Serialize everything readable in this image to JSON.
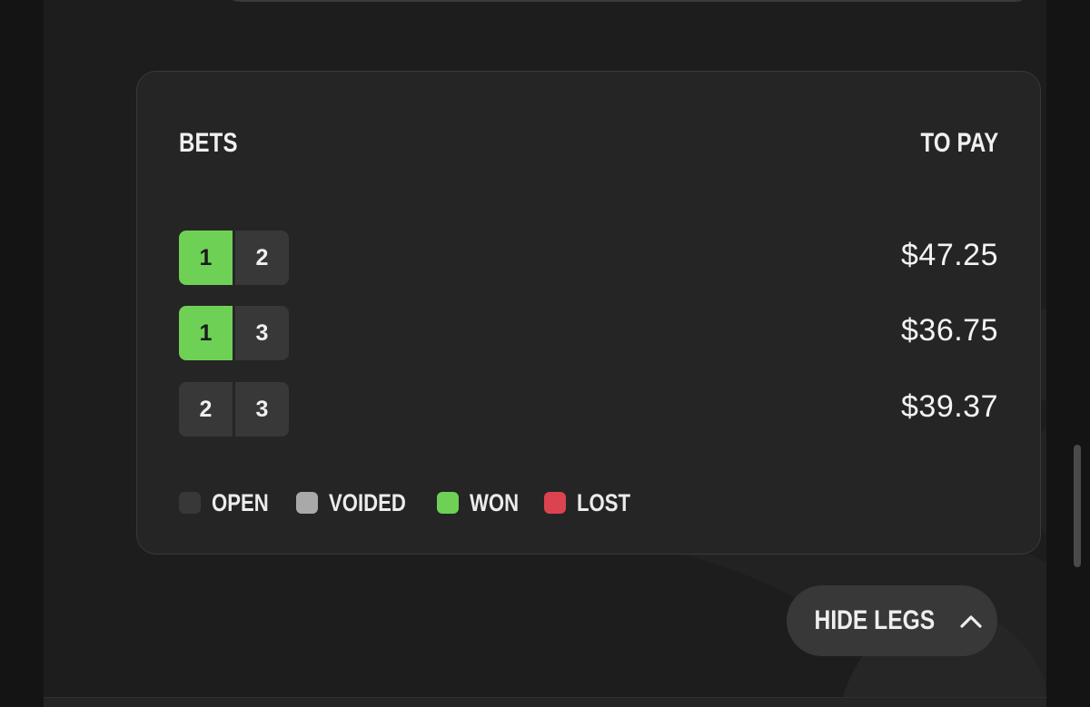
{
  "bets_card": {
    "bets_heading": "BETS",
    "to_pay_heading": "TO PAY",
    "rows": [
      {
        "legs": [
          {
            "label": "1",
            "status": "won"
          },
          {
            "label": "2",
            "status": "open"
          }
        ],
        "to_pay": "$47.25"
      },
      {
        "legs": [
          {
            "label": "1",
            "status": "won"
          },
          {
            "label": "3",
            "status": "open"
          }
        ],
        "to_pay": "$36.75"
      },
      {
        "legs": [
          {
            "label": "2",
            "status": "open"
          },
          {
            "label": "3",
            "status": "open"
          }
        ],
        "to_pay": "$39.37"
      }
    ],
    "legend": [
      {
        "label": "OPEN",
        "color": "#383838"
      },
      {
        "label": "VOIDED",
        "color": "#a9a9a9"
      },
      {
        "label": "WON",
        "color": "#6ed155"
      },
      {
        "label": "LOST",
        "color": "#db4351"
      }
    ]
  },
  "toggle": {
    "hide_legs_label": "HIDE LEGS",
    "icon": "chevron-up-icon"
  }
}
